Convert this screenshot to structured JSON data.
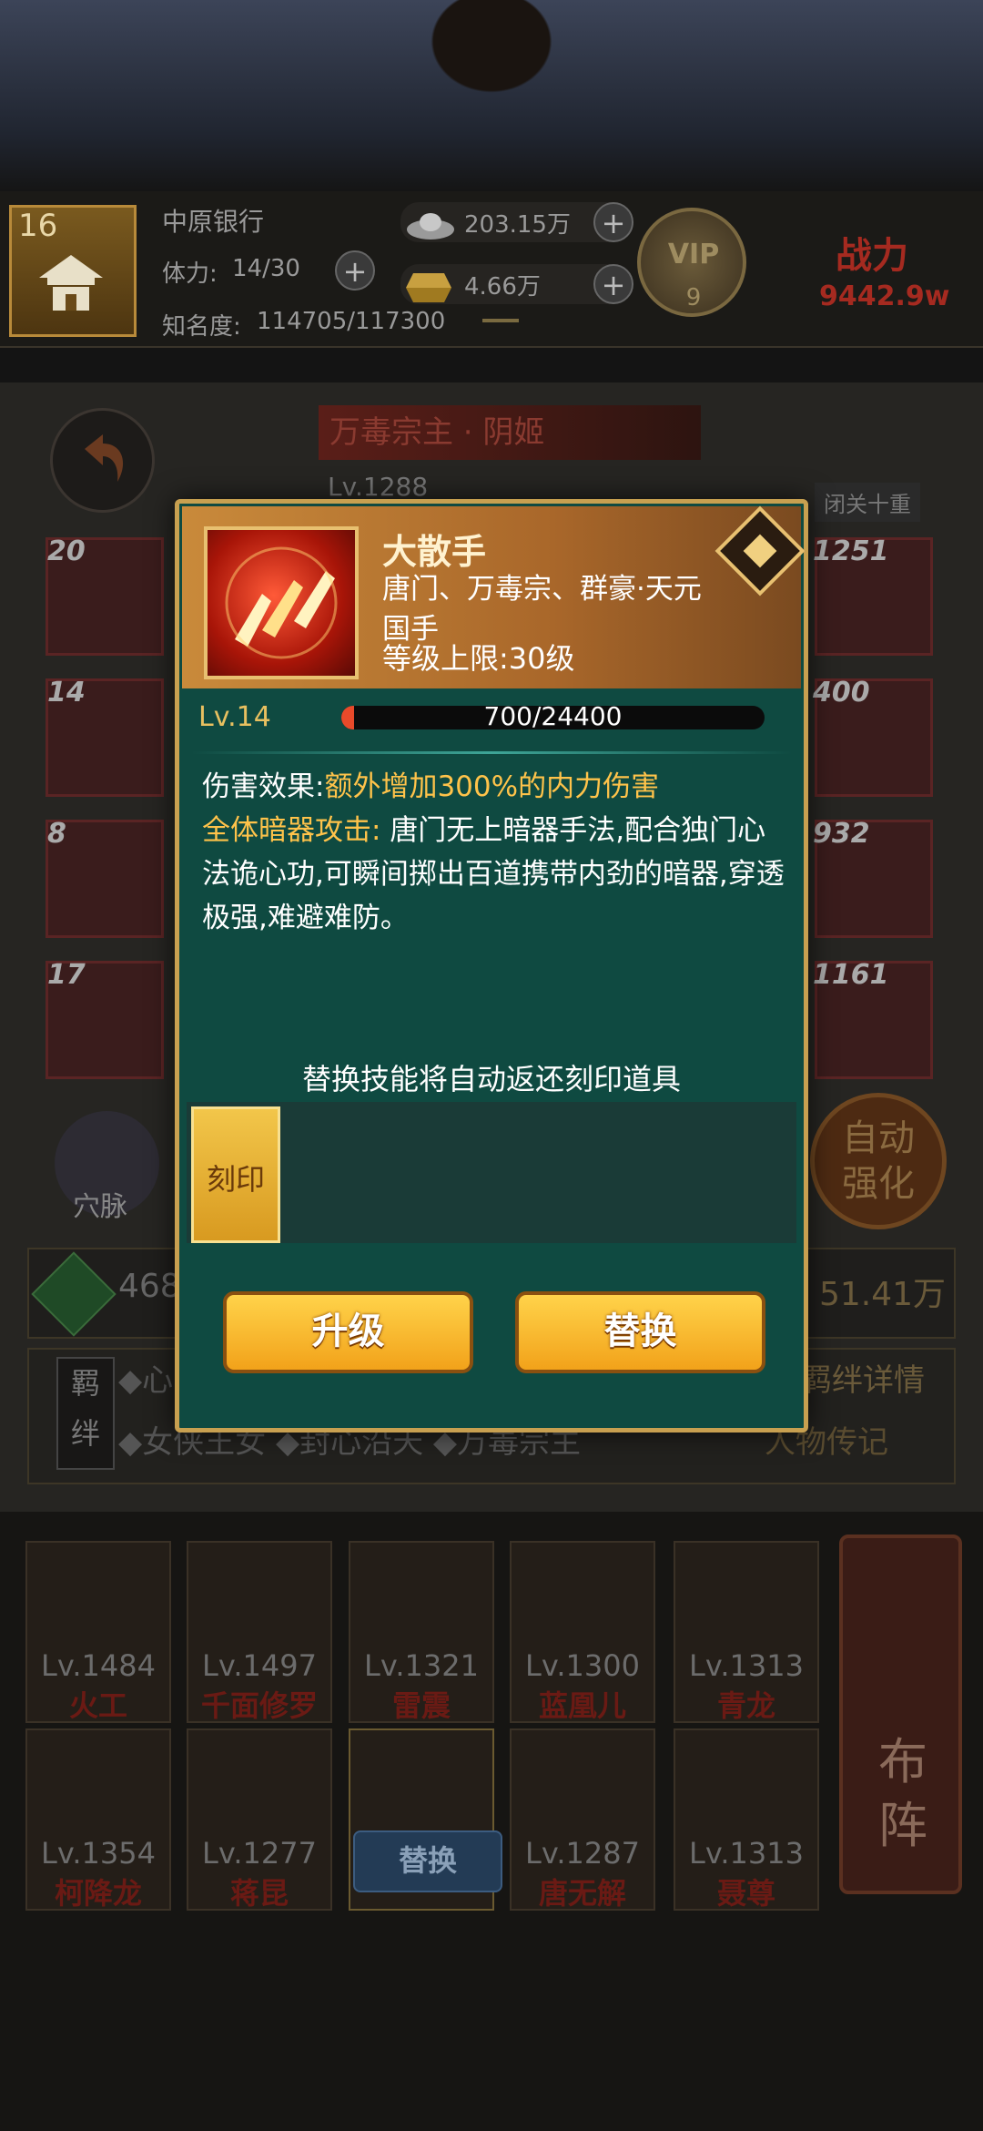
{
  "player": {
    "level": "16",
    "name": "中原银行",
    "stamina_label": "体力:",
    "stamina": "14/30",
    "fame_label": "知名度:",
    "fame": "114705/117300",
    "silver": "203.15万",
    "gold": "4.66万",
    "vip_label": "VIP",
    "vip_level": "9",
    "power_label": "战力",
    "power_value": "9442.9w"
  },
  "hero": {
    "title": "万毒宗主 · 阴姬",
    "level": "Lv.1288",
    "closed_label": "闭关十重",
    "slots_left": [
      "20",
      "14",
      "8",
      "17"
    ],
    "slots_right": [
      "1251",
      "400",
      "932",
      "1161"
    ],
    "meridian_label": "穴脉",
    "auto_label": "自动强化",
    "stat_left": "468",
    "stat_right": "51.41万",
    "bond_tag": "羁绊",
    "bond_detail": "羁绊详情",
    "bond_bio": "人物传记",
    "bond_row1": "◆心",
    "bond_row2": "◆女侠王女 ◆封心沿天 ◆万毒宗主"
  },
  "formation": {
    "row1": [
      {
        "lv": "Lv.1484",
        "name": "火工"
      },
      {
        "lv": "Lv.1497",
        "name": "千面修罗"
      },
      {
        "lv": "Lv.1321",
        "name": "雷震"
      },
      {
        "lv": "Lv.1300",
        "name": "蓝凰儿"
      },
      {
        "lv": "Lv.1313",
        "name": "青龙"
      }
    ],
    "row2": [
      {
        "lv": "Lv.1354",
        "name": "柯降龙"
      },
      {
        "lv": "Lv.1277",
        "name": "蒋昆"
      },
      {
        "lv": "",
        "name": ""
      },
      {
        "lv": "Lv.1287",
        "name": "唐无解"
      },
      {
        "lv": "Lv.1313",
        "name": "聂尊"
      }
    ],
    "replace_label": "替换",
    "layout_label": "布阵"
  },
  "modal": {
    "skill_name": "大散手",
    "skill_faction": "唐门、万毒宗、群豪·天元国手",
    "skill_cap": "等级上限:30级",
    "level": "Lv.14",
    "xp_current": 700,
    "xp_max": 24400,
    "xp_text": "700/24400",
    "effect_label": "伤害效果:",
    "effect_value": "额外增加300%的内力伤害",
    "attack_label": "全体暗器攻击:",
    "attack_desc": "唐门无上暗器手法,配合独门心法诡心功,可瞬间掷出百道携带内劲的暗器,穿透极强,难避难防。",
    "notice": "替换技能将自动返还刻印道具",
    "engrave_label": "刻印",
    "upgrade_label": "升级",
    "replace_label": "替换"
  },
  "colors": {
    "modal_bg": "#0f4a41",
    "gold_text": "#ffc34a",
    "button": "#f2a21a"
  }
}
